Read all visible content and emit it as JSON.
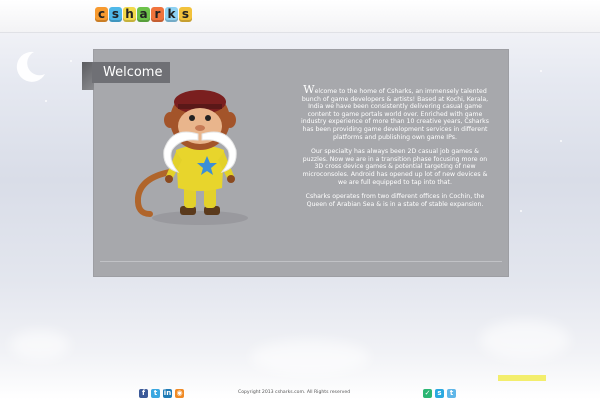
{
  "logo": {
    "letters": [
      "c",
      "s",
      "h",
      "a",
      "r",
      "k",
      "s"
    ],
    "colors": [
      "#f79a2f",
      "#4fb8e8",
      "#f2d94a",
      "#6cc24a",
      "#f0733c",
      "#8ed1f2",
      "#f2c23b"
    ]
  },
  "welcome": {
    "tab_label": "Welcome",
    "dropcap": "W",
    "paragraph1": "elcome to the home of Csharks, an immensely talented bunch of game developers & artists! Based at Kochi, Kerala, India we have been consistently delivering casual game content to game portals world over. Enriched with game industry experience of more than 10 creative years, Csharks has been providing game development services in different platforms and publishing own game IPs.",
    "paragraph2": "Our specialty has always been 2D casual job games & puzzles. Now we are in a transition phase focusing more on 3D cross device games & potential targeting of new microconsoles. Android has opened up lot of new devices & we are full equipped to tap into that.",
    "paragraph3": "Csharks operates from two different offices in Cochin, the Queen of Arabian Sea & is in a state of stable expansion."
  },
  "footer": {
    "copyright": "Copyright 2013 csharks.com. All Rights reserved",
    "social_left": [
      {
        "name": "facebook-icon",
        "glyph": "f",
        "color": "#3b5998"
      },
      {
        "name": "twitter-icon",
        "glyph": "t",
        "color": "#3aa7e0"
      },
      {
        "name": "linkedin-icon",
        "glyph": "in",
        "color": "#1f7bb6"
      },
      {
        "name": "rss-icon",
        "glyph": "◉",
        "color": "#f08a24"
      }
    ],
    "social_right": [
      {
        "name": "green-share-icon",
        "glyph": "✓",
        "color": "#2bb673"
      },
      {
        "name": "skype-icon",
        "glyph": "s",
        "color": "#2aa9e0"
      },
      {
        "name": "twitter-icon-right",
        "glyph": "t",
        "color": "#5fb6e8"
      }
    ]
  },
  "colors": {
    "panel": "#a7a8ac",
    "tab": "#6f7075",
    "accent_yellow": "#f2ec5d"
  }
}
